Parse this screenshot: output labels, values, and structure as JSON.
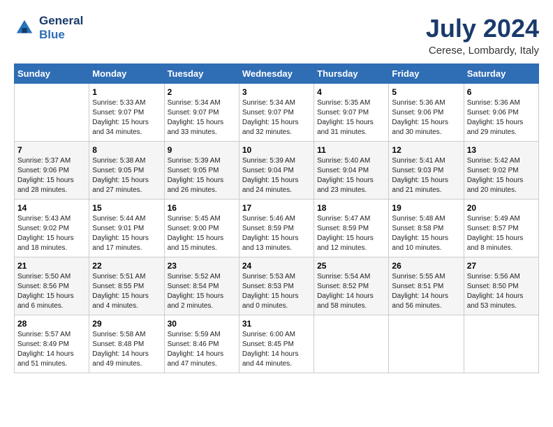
{
  "header": {
    "logo_line1": "General",
    "logo_line2": "Blue",
    "month_title": "July 2024",
    "location": "Cerese, Lombardy, Italy"
  },
  "columns": [
    "Sunday",
    "Monday",
    "Tuesday",
    "Wednesday",
    "Thursday",
    "Friday",
    "Saturday"
  ],
  "weeks": [
    [
      {
        "day": "",
        "info": ""
      },
      {
        "day": "1",
        "info": "Sunrise: 5:33 AM\nSunset: 9:07 PM\nDaylight: 15 hours\nand 34 minutes."
      },
      {
        "day": "2",
        "info": "Sunrise: 5:34 AM\nSunset: 9:07 PM\nDaylight: 15 hours\nand 33 minutes."
      },
      {
        "day": "3",
        "info": "Sunrise: 5:34 AM\nSunset: 9:07 PM\nDaylight: 15 hours\nand 32 minutes."
      },
      {
        "day": "4",
        "info": "Sunrise: 5:35 AM\nSunset: 9:07 PM\nDaylight: 15 hours\nand 31 minutes."
      },
      {
        "day": "5",
        "info": "Sunrise: 5:36 AM\nSunset: 9:06 PM\nDaylight: 15 hours\nand 30 minutes."
      },
      {
        "day": "6",
        "info": "Sunrise: 5:36 AM\nSunset: 9:06 PM\nDaylight: 15 hours\nand 29 minutes."
      }
    ],
    [
      {
        "day": "7",
        "info": "Sunrise: 5:37 AM\nSunset: 9:06 PM\nDaylight: 15 hours\nand 28 minutes."
      },
      {
        "day": "8",
        "info": "Sunrise: 5:38 AM\nSunset: 9:05 PM\nDaylight: 15 hours\nand 27 minutes."
      },
      {
        "day": "9",
        "info": "Sunrise: 5:39 AM\nSunset: 9:05 PM\nDaylight: 15 hours\nand 26 minutes."
      },
      {
        "day": "10",
        "info": "Sunrise: 5:39 AM\nSunset: 9:04 PM\nDaylight: 15 hours\nand 24 minutes."
      },
      {
        "day": "11",
        "info": "Sunrise: 5:40 AM\nSunset: 9:04 PM\nDaylight: 15 hours\nand 23 minutes."
      },
      {
        "day": "12",
        "info": "Sunrise: 5:41 AM\nSunset: 9:03 PM\nDaylight: 15 hours\nand 21 minutes."
      },
      {
        "day": "13",
        "info": "Sunrise: 5:42 AM\nSunset: 9:02 PM\nDaylight: 15 hours\nand 20 minutes."
      }
    ],
    [
      {
        "day": "14",
        "info": "Sunrise: 5:43 AM\nSunset: 9:02 PM\nDaylight: 15 hours\nand 18 minutes."
      },
      {
        "day": "15",
        "info": "Sunrise: 5:44 AM\nSunset: 9:01 PM\nDaylight: 15 hours\nand 17 minutes."
      },
      {
        "day": "16",
        "info": "Sunrise: 5:45 AM\nSunset: 9:00 PM\nDaylight: 15 hours\nand 15 minutes."
      },
      {
        "day": "17",
        "info": "Sunrise: 5:46 AM\nSunset: 8:59 PM\nDaylight: 15 hours\nand 13 minutes."
      },
      {
        "day": "18",
        "info": "Sunrise: 5:47 AM\nSunset: 8:59 PM\nDaylight: 15 hours\nand 12 minutes."
      },
      {
        "day": "19",
        "info": "Sunrise: 5:48 AM\nSunset: 8:58 PM\nDaylight: 15 hours\nand 10 minutes."
      },
      {
        "day": "20",
        "info": "Sunrise: 5:49 AM\nSunset: 8:57 PM\nDaylight: 15 hours\nand 8 minutes."
      }
    ],
    [
      {
        "day": "21",
        "info": "Sunrise: 5:50 AM\nSunset: 8:56 PM\nDaylight: 15 hours\nand 6 minutes."
      },
      {
        "day": "22",
        "info": "Sunrise: 5:51 AM\nSunset: 8:55 PM\nDaylight: 15 hours\nand 4 minutes."
      },
      {
        "day": "23",
        "info": "Sunrise: 5:52 AM\nSunset: 8:54 PM\nDaylight: 15 hours\nand 2 minutes."
      },
      {
        "day": "24",
        "info": "Sunrise: 5:53 AM\nSunset: 8:53 PM\nDaylight: 15 hours\nand 0 minutes."
      },
      {
        "day": "25",
        "info": "Sunrise: 5:54 AM\nSunset: 8:52 PM\nDaylight: 14 hours\nand 58 minutes."
      },
      {
        "day": "26",
        "info": "Sunrise: 5:55 AM\nSunset: 8:51 PM\nDaylight: 14 hours\nand 56 minutes."
      },
      {
        "day": "27",
        "info": "Sunrise: 5:56 AM\nSunset: 8:50 PM\nDaylight: 14 hours\nand 53 minutes."
      }
    ],
    [
      {
        "day": "28",
        "info": "Sunrise: 5:57 AM\nSunset: 8:49 PM\nDaylight: 14 hours\nand 51 minutes."
      },
      {
        "day": "29",
        "info": "Sunrise: 5:58 AM\nSunset: 8:48 PM\nDaylight: 14 hours\nand 49 minutes."
      },
      {
        "day": "30",
        "info": "Sunrise: 5:59 AM\nSunset: 8:46 PM\nDaylight: 14 hours\nand 47 minutes."
      },
      {
        "day": "31",
        "info": "Sunrise: 6:00 AM\nSunset: 8:45 PM\nDaylight: 14 hours\nand 44 minutes."
      },
      {
        "day": "",
        "info": ""
      },
      {
        "day": "",
        "info": ""
      },
      {
        "day": "",
        "info": ""
      }
    ]
  ]
}
